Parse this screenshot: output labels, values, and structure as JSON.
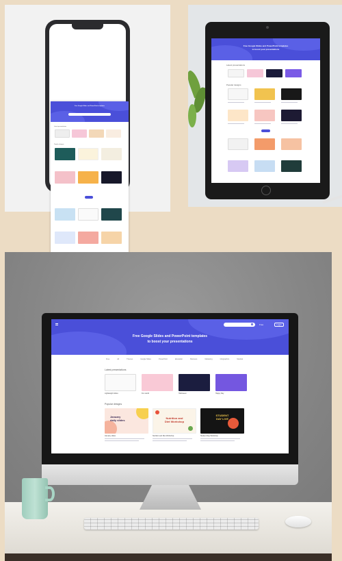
{
  "colors": {
    "background": "#ecdcc4",
    "brand": "#4a4fd9",
    "brand_light": "#5a60e6",
    "phone_frame": "#2b2b2e",
    "tablet_frame": "#1a1a1a",
    "monitor_frame": "#161616",
    "wall": "#8b8b8b",
    "mug": "#a8d5c5"
  },
  "desktop_site": {
    "hero_title_line1": "Free Google Slides and PowerPoint templates",
    "hero_title_line2": "to boost your presentations",
    "search_placeholder": "Search...",
    "header_link_1": "Free",
    "header_link_2": "Login",
    "nav": [
      "Free",
      "All",
      "Themes",
      "Google Slides",
      "PowerPoint",
      "Education",
      "Business",
      "Marketing",
      "Infographics",
      "Medical"
    ],
    "section_latest": "Latest presentations",
    "section_popular": "Popular designs",
    "latest_captions": [
      "Lightweight slides",
      "Fun world",
      "Halloween",
      "Happy Day"
    ],
    "popular_captions": [
      "January slides",
      "Nutrition and Diet Workshop",
      "Student Day Workshop"
    ],
    "popular_card_titles": [
      "January\ndaily slides",
      "Nutrition and\nDiet Workshop",
      "STUDENT\nDAY LIVE"
    ]
  },
  "icons": [
    "menu-icon",
    "search-icon",
    "home-button-icon",
    "keyboard-icon",
    "mouse-icon",
    "mug-icon",
    "plant-icon"
  ]
}
